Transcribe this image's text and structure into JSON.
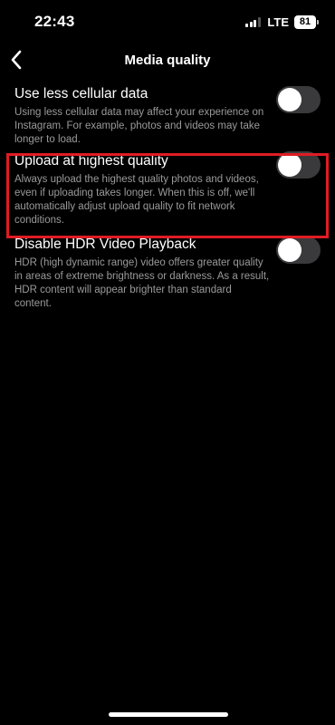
{
  "status_bar": {
    "time": "22:43",
    "network": "LTE",
    "battery": "81"
  },
  "header": {
    "title": "Media quality",
    "back_icon": "chevron-left-icon"
  },
  "settings": [
    {
      "title": "Use less cellular data",
      "description": "Using less cellular data may affect your experience on Instagram. For example, photos and videos may take longer to load.",
      "enabled": false
    },
    {
      "title": "Upload at highest quality",
      "description": "Always upload the highest quality photos and videos, even if uploading takes longer. When this is off, we'll automatically adjust upload quality to fit network conditions.",
      "enabled": false,
      "highlighted": true
    },
    {
      "title": "Disable HDR Video Playback",
      "description": "HDR (high dynamic range) video offers greater quality in areas of extreme brightness or darkness. As a result, HDR content will appear brighter than standard content.",
      "enabled": false
    }
  ],
  "colors": {
    "background": "#000000",
    "highlight": "#e01c24",
    "toggle_off": "#3a3a3c"
  }
}
